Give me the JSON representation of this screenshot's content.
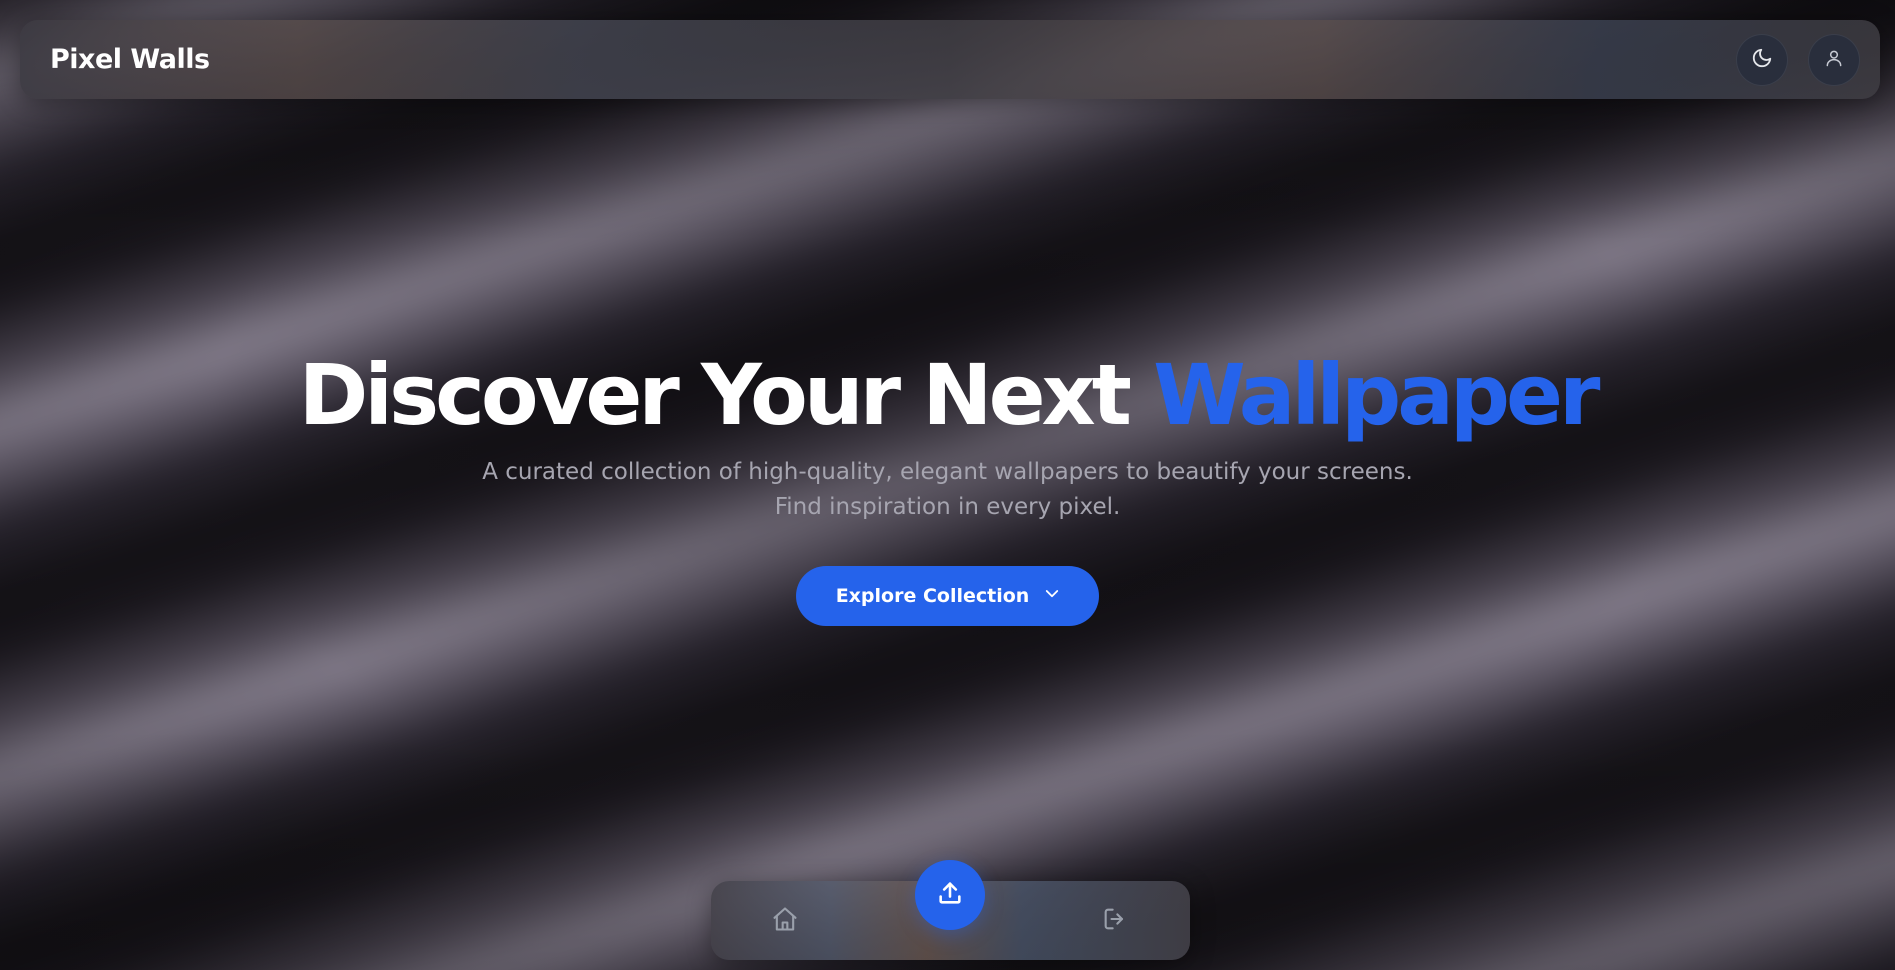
{
  "header": {
    "brand": "Pixel Walls",
    "theme_toggle_icon": "moon-icon",
    "profile_icon": "user-icon"
  },
  "hero": {
    "title_prefix": "Discover Your Next ",
    "title_accent": "Wallpaper",
    "subtitle": "A curated collection of high-quality, elegant wallpapers to beautify your screens. Find inspiration in every pixel.",
    "cta_label": "Explore Collection",
    "cta_icon": "chevron-down-icon"
  },
  "bottom_nav": {
    "items": [
      {
        "icon": "home-icon"
      },
      {
        "icon": "upload-icon"
      },
      {
        "icon": "logout-icon"
      }
    ]
  },
  "colors": {
    "accent": "#2563eb",
    "text_primary": "#ffffff",
    "text_muted": "#a6a5b0"
  }
}
